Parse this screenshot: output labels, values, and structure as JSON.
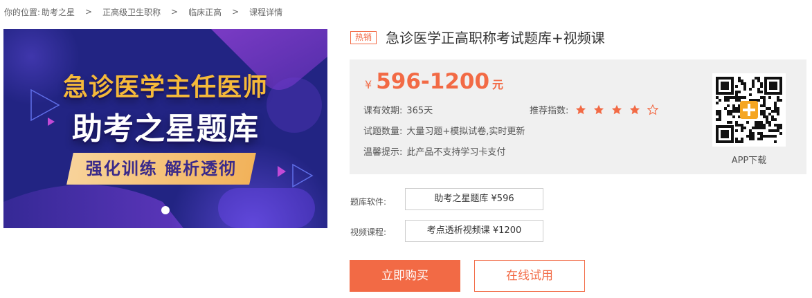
{
  "breadcrumb": {
    "prefix": "你的位置:",
    "items": [
      "助考之星",
      "正高级卫生职称",
      "临床正高",
      "课程详情"
    ],
    "separator": ">"
  },
  "banner": {
    "headline1": "急诊医学主任医师",
    "headline2": "助考之星题库",
    "tagline": "强化训练 解析透彻",
    "colors": {
      "background": "#241f7a",
      "accent_gold": "#f5b93a",
      "accent_purple": "#7a3fc4"
    }
  },
  "product": {
    "badge": "热销",
    "title": "急诊医学正高职称考试题库+视频课"
  },
  "pricing": {
    "currency": "¥",
    "amount": "596-1200",
    "unit": "元"
  },
  "info": {
    "validity_label": "课有效期:",
    "validity_value": "365天",
    "questions_label": "试题数量:",
    "questions_value": "大量习题+模拟试卷,实时更新",
    "notice_label": "温馨提示:",
    "notice_value": "此产品不支持学习卡支付",
    "rating_label": "推荐指数:",
    "rating_value": 4,
    "rating_max": 5
  },
  "app": {
    "download_label": "APP下载",
    "qr_icon": "qr-code-icon"
  },
  "options": {
    "software_label": "题库软件:",
    "software_value": "助考之星题库   ¥596",
    "video_label": "视频课程:",
    "video_value": "考点透析视频课   ¥1200"
  },
  "actions": {
    "buy_label": "立即购买",
    "trial_label": "在线试用"
  },
  "colors": {
    "accent": "#f26a45",
    "panel_bg": "#f0f0f0"
  }
}
